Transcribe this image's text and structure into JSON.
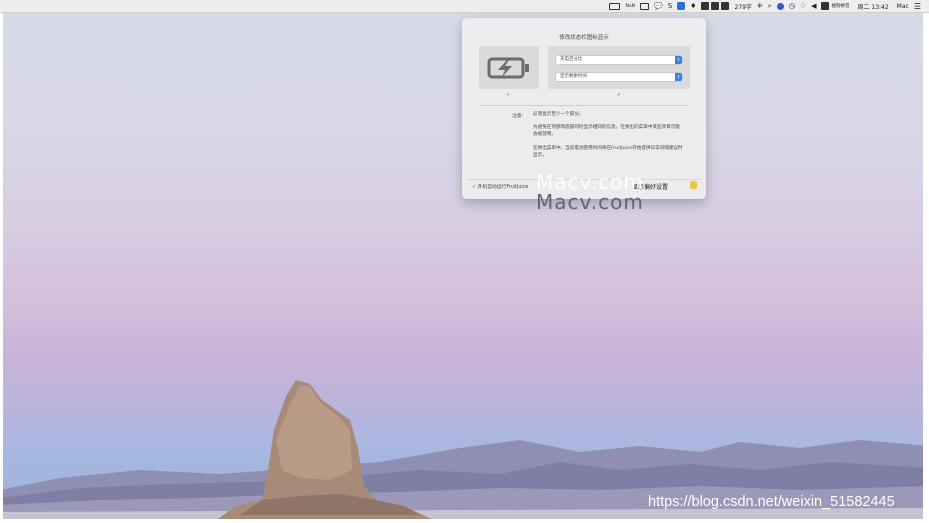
{
  "menubar": {
    "ime_label": "NaN",
    "word_count": "279字",
    "input_method": "搜狗拼音",
    "datetime": "周二 13:42",
    "user": "Mac",
    "menu_icon": "list-icon"
  },
  "panel": {
    "title": "修改状态栏图标显示",
    "select_top": "充电百分比",
    "select_bottom": "显示剩余时间",
    "check": "✓",
    "note_label": "注意：",
    "note_line1": "必须显示至少一个部分。",
    "note_line2": "为避免在顶部和底部同时显示相同的信息，在弹出的菜单中某些项目可能会被禁用。",
    "note_line3": "在弹出菜单中，当前电池使用时间将在FruitJuice开始提供日常间隔建议时显示。",
    "launch_label": "✓ 开机自动运行FruitJuice",
    "prefs_label": "显示偏好设置"
  },
  "watermark": {
    "primary": "Macv.com",
    "secondary": "Macv.com",
    "csdn": "https://blog.csdn.net/weixin_51582445"
  },
  "colors": {
    "accent_blue": "#3b82e6",
    "battery_icon": "#6b6b6b"
  }
}
